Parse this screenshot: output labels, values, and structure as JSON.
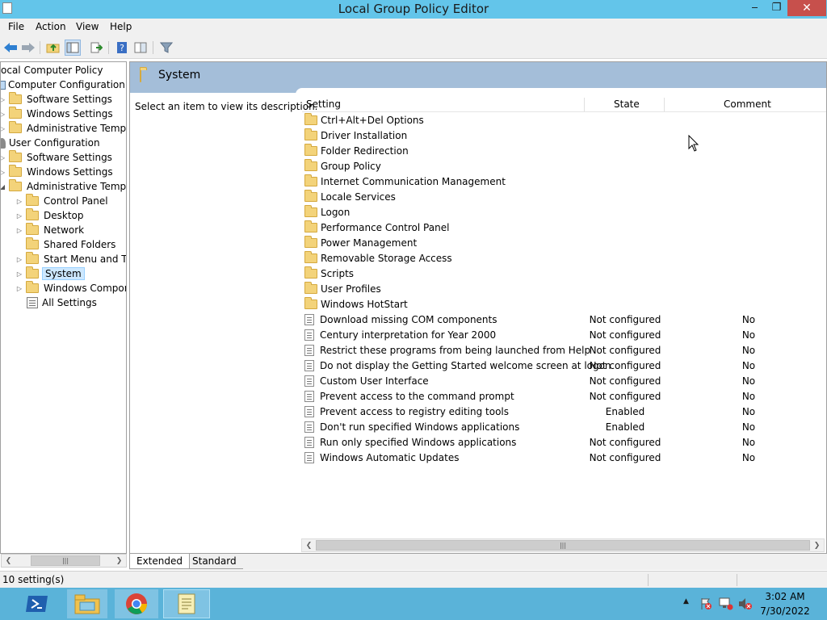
{
  "window": {
    "title": "Local Group Policy Editor",
    "minimize": "‒",
    "maximize": "❐",
    "close": "✕"
  },
  "menu": {
    "file": "File",
    "action": "Action",
    "view": "View",
    "help": "Help"
  },
  "tree": {
    "items": [
      {
        "label": "ocal Computer Policy"
      },
      {
        "label": "Computer Configuration"
      },
      {
        "label": "Software Settings"
      },
      {
        "label": "Windows Settings"
      },
      {
        "label": "Administrative Templa"
      },
      {
        "label": "User Configuration"
      },
      {
        "label": "Software Settings"
      },
      {
        "label": "Windows Settings"
      },
      {
        "label": "Administrative Templa"
      },
      {
        "label": "Control Panel"
      },
      {
        "label": "Desktop"
      },
      {
        "label": "Network"
      },
      {
        "label": "Shared Folders"
      },
      {
        "label": "Start Menu and Tas"
      },
      {
        "label": "System"
      },
      {
        "label": "Windows Compone"
      },
      {
        "label": "All Settings"
      }
    ]
  },
  "right": {
    "header_title": "System",
    "description": "Select an item to view its description.",
    "columns": {
      "setting": "Setting",
      "state": "State",
      "comment": "Comment"
    },
    "folders": [
      "Ctrl+Alt+Del Options",
      "Driver Installation",
      "Folder Redirection",
      "Group Policy",
      "Internet Communication Management",
      "Locale Services",
      "Logon",
      "Performance Control Panel",
      "Power Management",
      "Removable Storage Access",
      "Scripts",
      "User Profiles",
      "Windows HotStart"
    ],
    "settings": [
      {
        "name": "Download missing COM components",
        "state": "Not configured",
        "comment": "No"
      },
      {
        "name": "Century interpretation for Year 2000",
        "state": "Not configured",
        "comment": "No"
      },
      {
        "name": "Restrict these programs from being launched from Help",
        "state": "Not configured",
        "comment": "No"
      },
      {
        "name": "Do not display the Getting Started welcome screen at logon",
        "state": "Not configured",
        "comment": "No"
      },
      {
        "name": "Custom User Interface",
        "state": "Not configured",
        "comment": "No"
      },
      {
        "name": "Prevent access to the command prompt",
        "state": "Not configured",
        "comment": "No"
      },
      {
        "name": "Prevent access to registry editing tools",
        "state": "Enabled",
        "comment": "No"
      },
      {
        "name": "Don't run specified Windows applications",
        "state": "Enabled",
        "comment": "No"
      },
      {
        "name": "Run only specified Windows applications",
        "state": "Not configured",
        "comment": "No"
      },
      {
        "name": "Windows Automatic Updates",
        "state": "Not configured",
        "comment": "No"
      }
    ]
  },
  "tabs": {
    "extended": "Extended",
    "standard": "Standard"
  },
  "status": {
    "text": "10 setting(s)"
  },
  "taskbar": {
    "time": "3:02 AM",
    "date": "7/30/2022"
  },
  "icons": {
    "back": "back-arrow-icon",
    "forward": "forward-arrow-icon"
  }
}
